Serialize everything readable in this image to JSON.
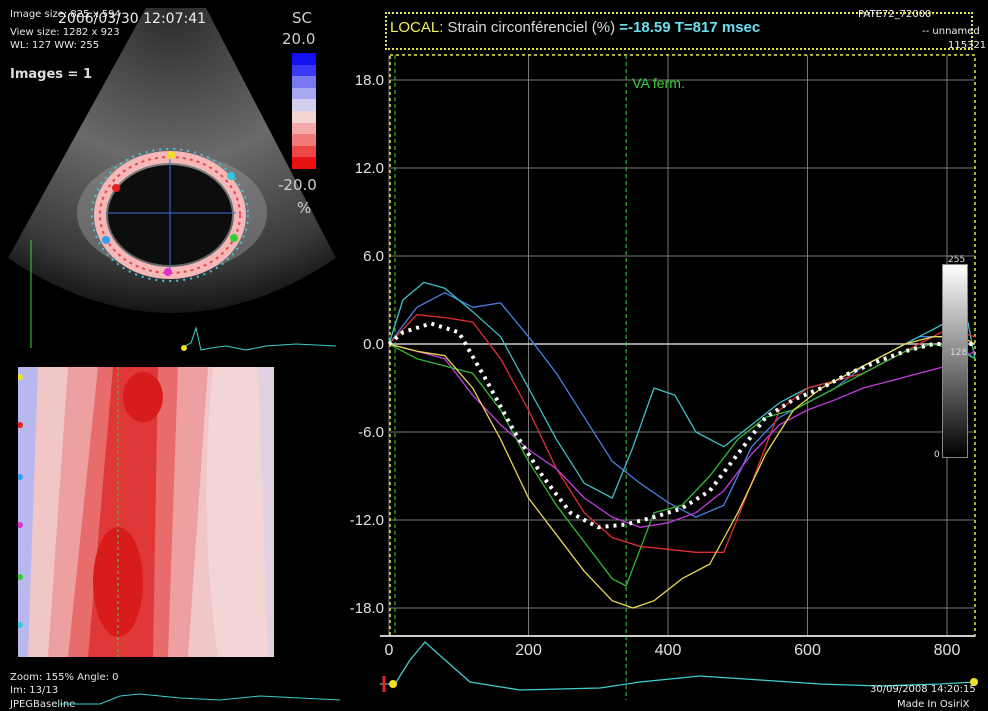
{
  "overlay": {
    "image_size": "Image size: 825 x 594",
    "view_size": "View size: 1282 x 923",
    "window_level": "WL: 127 WW: 255",
    "timestamp": "2006/03/30 12:07:41",
    "images_count": "Images = 1",
    "zoom": "Zoom: 155% Angle: 0",
    "image_index": "Im: 13/13",
    "compression": "JPEGBaseline",
    "datetime": "30/09/2008 14:20:15",
    "made_in": "Made In OsiriX",
    "patient": "PATE72_72000",
    "unnamed": "-- unnamed",
    "series_id": "115321"
  },
  "strain_scale": {
    "label": "SC",
    "max": "20.0",
    "min": "-20.0",
    "unit": "%",
    "colors": [
      "#1010f0",
      "#3a3af6",
      "#7878f2",
      "#a8a8f0",
      "#d0d0ee",
      "#f4d4d4",
      "#f4aaaa",
      "#f07a7a",
      "#ec4646",
      "#e81212"
    ]
  },
  "gray_scale": {
    "max": "255",
    "mid": "128",
    "min": "0"
  },
  "title": {
    "mode": "LOCAL:",
    "metric": " Strain circonférenciel (%) ",
    "value": "=-18.59",
    "time": "T=817 msec"
  },
  "chart_data": {
    "type": "line",
    "xlim": [
      0,
      840
    ],
    "ylim": [
      -20,
      20
    ],
    "x_ticks": [
      "0",
      "200",
      "400",
      "600",
      "800"
    ],
    "y_ticks": [
      "18.0",
      "12.0",
      "6.0",
      "0.0",
      "-6.0",
      "-12.0",
      "-18.0"
    ],
    "y_tick_values": [
      18,
      12,
      6,
      0,
      -6,
      -12,
      -18
    ],
    "annotation": {
      "label": "VA ferm.",
      "x": 340
    },
    "colors": {
      "axis": "#cccccc",
      "grid": "#777777",
      "marker": "#3ecf3e",
      "border": "#e6e64c",
      "mean": "#ffffff"
    },
    "series": [
      {
        "color": "#4a7fe0",
        "x": [
          0,
          40,
          80,
          120,
          160,
          200,
          240,
          280,
          320,
          360,
          400,
          440,
          480,
          520,
          560,
          600,
          640,
          680,
          720,
          760,
          800,
          840
        ],
        "y": [
          0,
          2.5,
          3.5,
          2.5,
          2.8,
          0.5,
          -2.0,
          -5,
          -8,
          -9.5,
          -10.8,
          -11.8,
          -11,
          -7,
          -5,
          -4,
          -3,
          -1.5,
          -0.5,
          0.5,
          0.5,
          -1
        ]
      },
      {
        "color": "#3ec0c8",
        "x": [
          0,
          20,
          50,
          80,
          120,
          160,
          200,
          240,
          280,
          320,
          350,
          380,
          410,
          440,
          480,
          520,
          560,
          600,
          640,
          680,
          720,
          760,
          800,
          830,
          840
        ],
        "y": [
          0,
          3,
          4.2,
          3.8,
          2.2,
          0.5,
          -3,
          -6.5,
          -9.5,
          -10.5,
          -7,
          -3,
          -3.5,
          -6,
          -7,
          -5.5,
          -4,
          -3,
          -2.5,
          -1.5,
          -0.5,
          0.5,
          1.5,
          1.5,
          -1
        ]
      },
      {
        "color": "#e03030",
        "x": [
          0,
          40,
          80,
          120,
          160,
          200,
          240,
          280,
          320,
          360,
          400,
          440,
          480,
          520,
          560,
          600,
          640,
          680,
          720,
          760,
          800,
          840
        ],
        "y": [
          0,
          2,
          1.8,
          1.5,
          -1,
          -4.5,
          -8.5,
          -11.5,
          -13.2,
          -13.8,
          -14,
          -14.2,
          -14.2,
          -9.5,
          -4.5,
          -3,
          -2.5,
          -2,
          -1,
          0,
          1,
          0.5
        ]
      },
      {
        "color": "#c43ce0",
        "x": [
          0,
          40,
          80,
          120,
          160,
          200,
          240,
          280,
          320,
          360,
          400,
          440,
          480,
          520,
          560,
          600,
          640,
          680,
          720,
          760,
          800,
          840
        ],
        "y": [
          0,
          -0.5,
          -1,
          -3.5,
          -5.5,
          -7.2,
          -8.5,
          -10.5,
          -11.8,
          -12.5,
          -12.2,
          -11.5,
          -10,
          -7.5,
          -5.5,
          -4.5,
          -3.8,
          -3,
          -2.5,
          -2,
          -1.5,
          -0.5
        ]
      },
      {
        "color": "#33b833",
        "x": [
          0,
          40,
          80,
          120,
          160,
          200,
          240,
          280,
          320,
          340,
          360,
          380,
          420,
          460,
          500,
          540,
          580,
          620,
          660,
          700,
          740,
          780,
          820,
          840
        ],
        "y": [
          0,
          -1,
          -1.5,
          -2,
          -4.5,
          -8,
          -11,
          -13.5,
          -16,
          -16.5,
          -14,
          -11.5,
          -11,
          -9,
          -6.5,
          -5,
          -4.5,
          -3.5,
          -2.5,
          -1.5,
          -0.5,
          0,
          -0.5,
          -1
        ]
      },
      {
        "color": "#e8d850",
        "x": [
          0,
          40,
          80,
          120,
          160,
          200,
          240,
          280,
          320,
          350,
          380,
          420,
          460,
          500,
          540,
          580,
          620,
          660,
          700,
          740,
          780,
          820,
          840
        ],
        "y": [
          0,
          -0.5,
          -0.8,
          -3,
          -6.5,
          -10.5,
          -13,
          -15.5,
          -17.5,
          -18,
          -17.5,
          -16,
          -15,
          -11.5,
          -7.5,
          -4.5,
          -3,
          -2,
          -1,
          0,
          0.5,
          0.5,
          0
        ]
      },
      {
        "color": "#ffffff",
        "dashed": true,
        "x": [
          0,
          20,
          60,
          100,
          140,
          180,
          220,
          260,
          300,
          340,
          380,
          420,
          460,
          500,
          540,
          580,
          620,
          660,
          700,
          740,
          780,
          820,
          840
        ],
        "y": [
          0,
          0.8,
          1.4,
          0.8,
          -2.5,
          -6,
          -9,
          -11.5,
          -12.5,
          -12.3,
          -11.8,
          -11.2,
          -10,
          -7.5,
          -5,
          -3.8,
          -3,
          -2,
          -1.2,
          -0.5,
          0,
          0,
          0
        ]
      }
    ]
  }
}
